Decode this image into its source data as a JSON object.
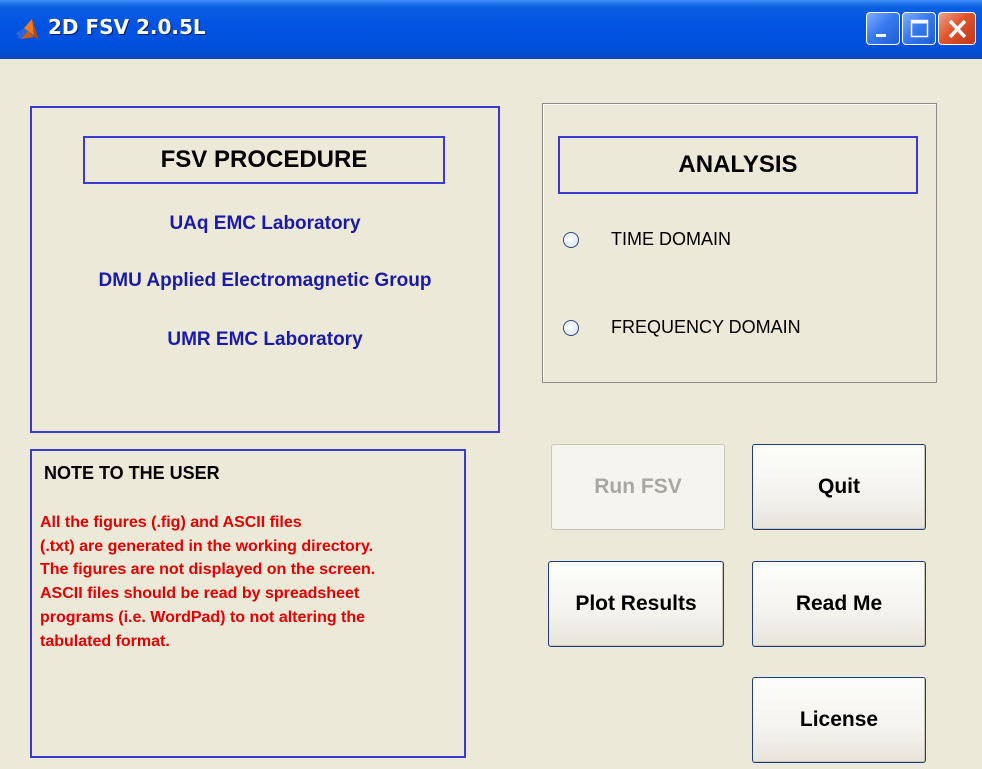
{
  "window": {
    "title": "2D FSV 2.0.5L",
    "controls": [
      "minimize-icon",
      "maximize-icon",
      "close-icon"
    ]
  },
  "procedure": {
    "title": "FSV PROCEDURE",
    "labs": [
      "UAq EMC Laboratory",
      "DMU Applied Electromagnetic Group",
      "UMR EMC Laboratory"
    ]
  },
  "analysis": {
    "title": "ANALYSIS",
    "options": [
      {
        "label": "TIME DOMAIN",
        "selected": false
      },
      {
        "label": "FREQUENCY DOMAIN",
        "selected": false
      }
    ]
  },
  "note": {
    "title": "NOTE TO THE USER",
    "lines": [
      "All the figures (.fig) and ASCII files",
      "(.txt) are generated in the working directory.",
      "The figures are not displayed on the screen.",
      "ASCII files should be read by spreadsheet",
      "programs (i.e. WordPad) to not altering the",
      "tabulated format."
    ]
  },
  "buttons": {
    "run": "Run FSV",
    "quit": "Quit",
    "plot": "Plot Results",
    "readme": "Read Me",
    "license": "License"
  },
  "colors": {
    "titlebar": "#0054e3",
    "panel_border": "#3a3ad0",
    "lab_text": "#1a1aa8",
    "note_text": "#e60000",
    "background": "#ece9d8"
  }
}
